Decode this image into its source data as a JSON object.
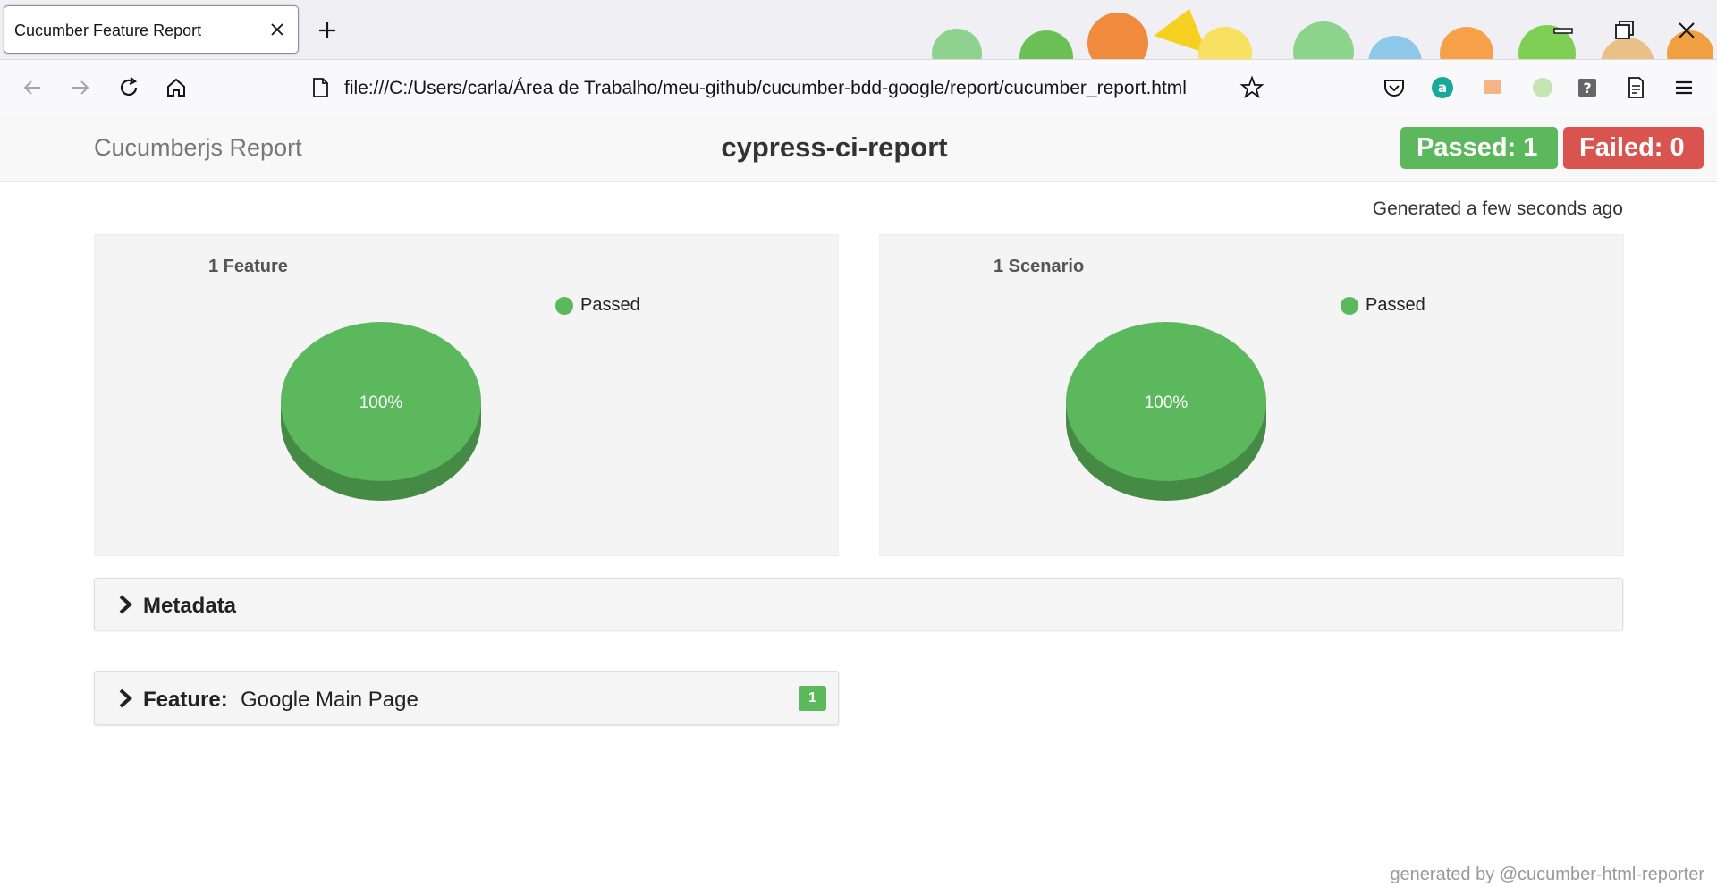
{
  "browser": {
    "tab_title": "Cucumber Feature Report",
    "url": "file:///C:/Users/carla/Área de Trabalho/meu-github/cucumber-bdd-google/report/cucumber_report.html"
  },
  "report": {
    "brand": "Cucumberjs Report",
    "project_name": "cypress-ci-report",
    "passed_badge": "Passed: 1",
    "failed_badge": "Failed: 0",
    "generated": "Generated a few seconds ago",
    "footer": "generated by @cucumber-html-reporter"
  },
  "chart_data": [
    {
      "type": "pie",
      "title": "1 Feature",
      "categories": [
        "Passed"
      ],
      "values": [
        100
      ],
      "data_labels": [
        "100%"
      ],
      "colors": [
        "#5cb85c"
      ],
      "legend": "top-right"
    },
    {
      "type": "pie",
      "title": "1 Scenario",
      "categories": [
        "Passed"
      ],
      "values": [
        100
      ],
      "data_labels": [
        "100%"
      ],
      "colors": [
        "#5cb85c"
      ],
      "legend": "top-right"
    }
  ],
  "sections": {
    "metadata_label": "Metadata",
    "feature_prefix": "Feature:",
    "feature_name": "Google Main Page",
    "feature_count": "1"
  },
  "colors": {
    "passed": "#5cb85c",
    "passed_dark": "#458a45",
    "failed": "#d9534f"
  }
}
